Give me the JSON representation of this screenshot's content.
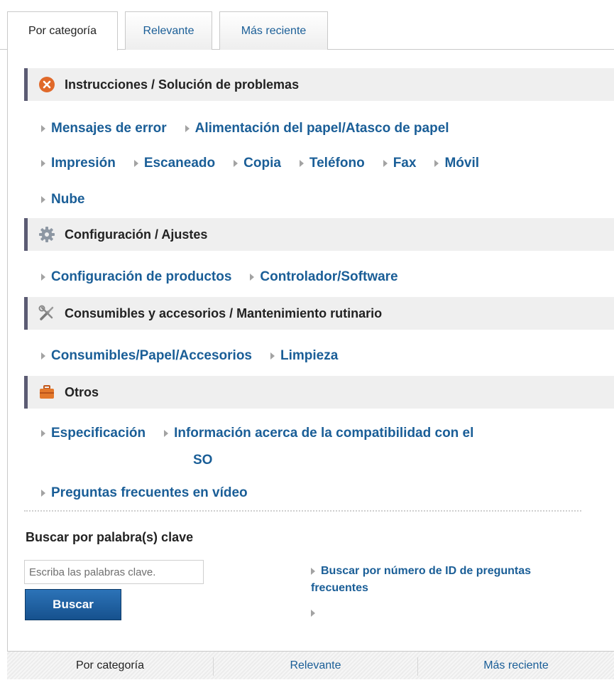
{
  "tabs": {
    "by_category": "Por categoría",
    "relevant": "Relevante",
    "most_recent": "Más reciente"
  },
  "sections": [
    {
      "title": "Instrucciones / Solución de problemas",
      "icon": "error-circle-icon",
      "links": [
        "Mensajes de error",
        "Alimentación del papel/Atasco de papel",
        "Impresión",
        "Escaneado",
        "Copia",
        "Teléfono",
        "Fax",
        "Móvil",
        "Nube"
      ]
    },
    {
      "title": "Configuración / Ajustes",
      "icon": "gear-icon",
      "links": [
        "Configuración de productos",
        "Controlador/Software"
      ]
    },
    {
      "title": "Consumibles y accesorios / Mantenimiento rutinario",
      "icon": "tools-icon",
      "links": [
        "Consumibles/Papel/Accesorios",
        "Limpieza"
      ]
    },
    {
      "title": "Otros",
      "icon": "toolbox-icon",
      "links": [
        "Especificación",
        "Información acerca de la compatibilidad con el",
        "SO",
        "Preguntas frecuentes en vídeo"
      ]
    }
  ],
  "keyword_search": {
    "title": "Buscar por palabra(s) clave",
    "placeholder": "Escriba las palabras clave.",
    "button": "Buscar",
    "id_link": "Buscar por número de ID de preguntas frecuentes"
  },
  "bottom_tabs": {
    "by_category": "Por categoría",
    "relevant": "Relevante",
    "most_recent": "Más reciente"
  },
  "colors": {
    "link": "#1a5e97",
    "section_bg": "#efefef",
    "section_bar": "#5b5b73",
    "button": "#1f62a3"
  }
}
